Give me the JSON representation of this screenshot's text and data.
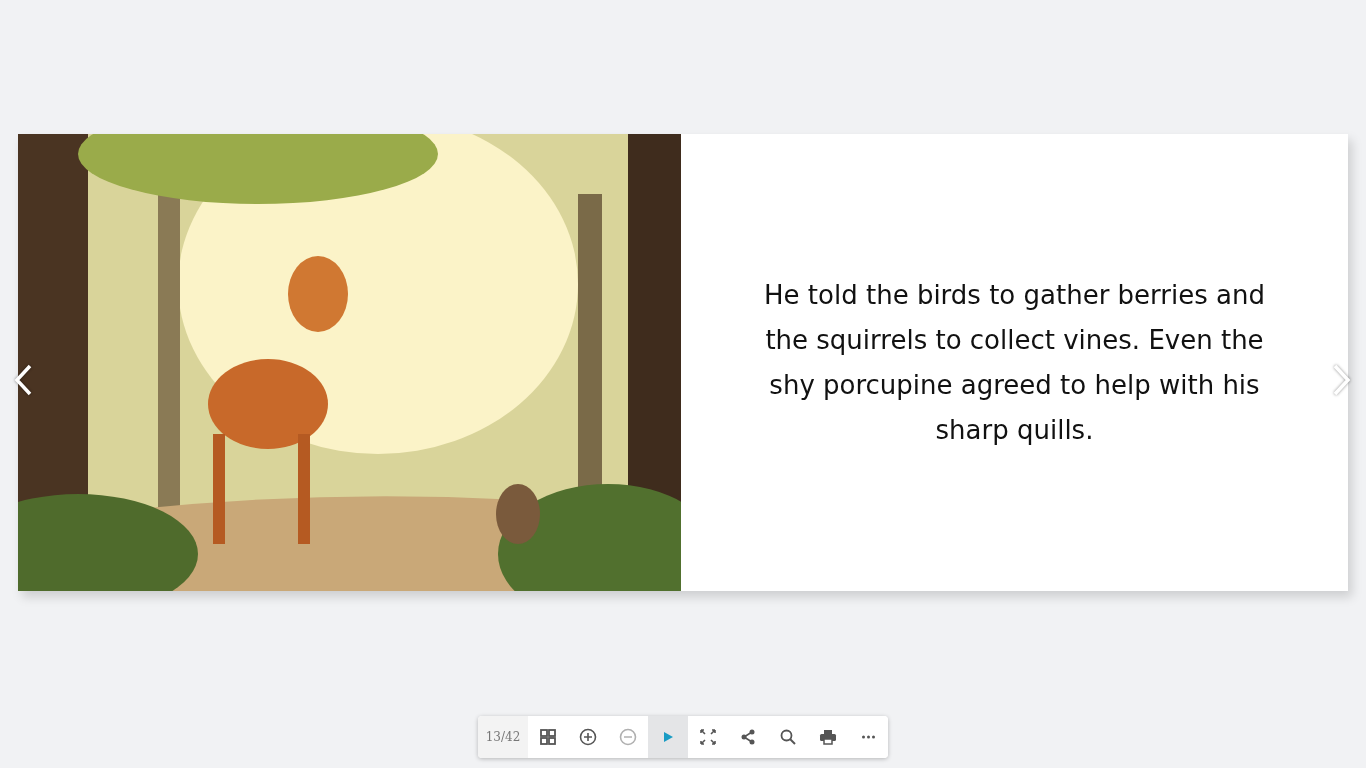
{
  "book": {
    "right_page": {
      "text": "He told the birds to gather berries and the squirrels to collect vines. Even the shy porcupine agreed to help with his sharp quills."
    }
  },
  "toolbar": {
    "page_indicator": "13/42",
    "buttons": [
      {
        "kind": "thumbnails",
        "disabled": false,
        "selected": false
      },
      {
        "kind": "zoom-in",
        "disabled": false,
        "selected": false
      },
      {
        "kind": "zoom-out",
        "disabled": true,
        "selected": false
      },
      {
        "kind": "play",
        "disabled": false,
        "selected": true
      },
      {
        "kind": "fullscreen",
        "disabled": false,
        "selected": false
      },
      {
        "kind": "share",
        "disabled": false,
        "selected": false
      },
      {
        "kind": "search",
        "disabled": false,
        "selected": false
      },
      {
        "kind": "print",
        "disabled": false,
        "selected": false
      },
      {
        "kind": "more",
        "disabled": false,
        "selected": false
      }
    ]
  }
}
